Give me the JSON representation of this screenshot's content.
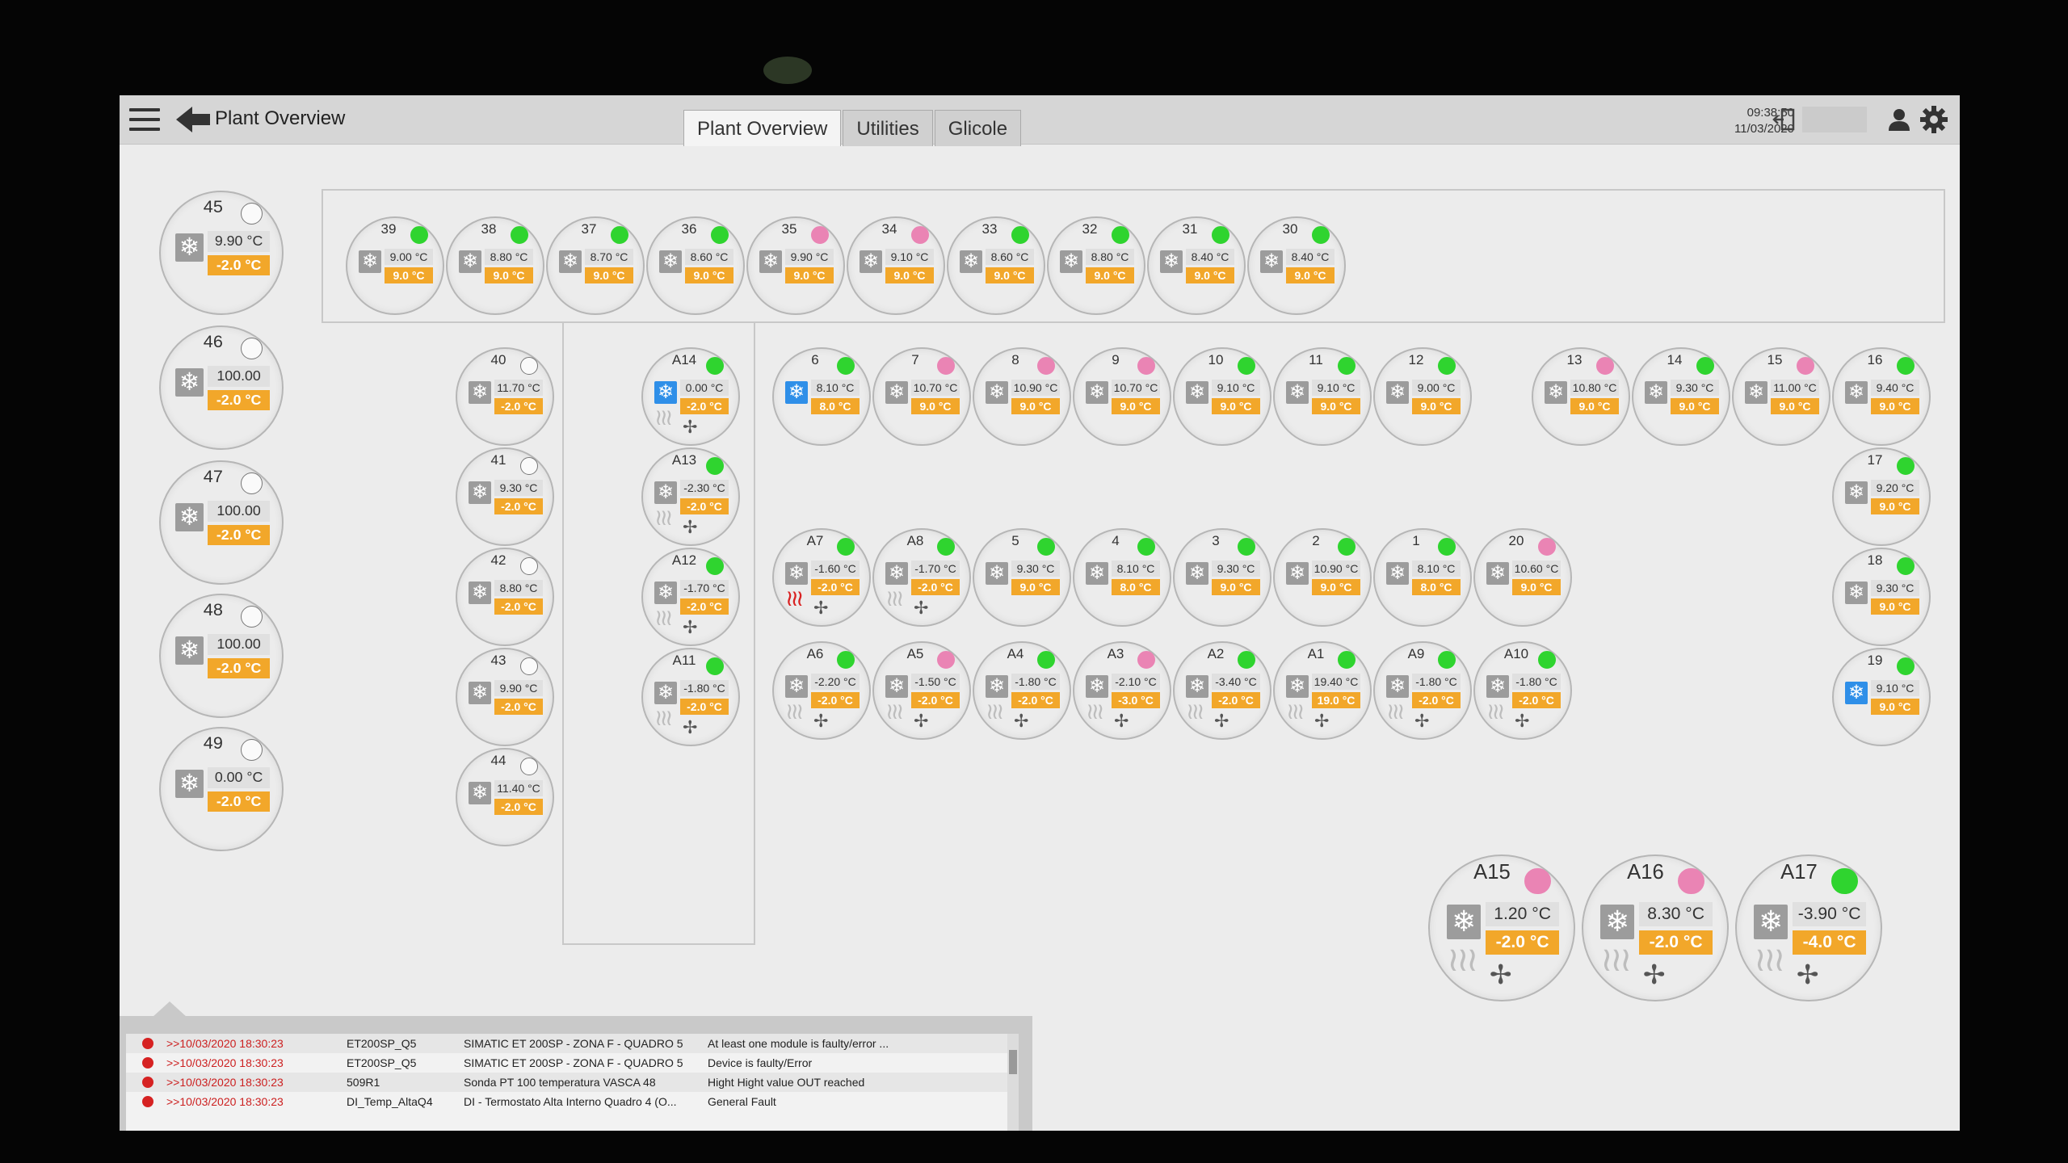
{
  "header": {
    "title": "Plant Overview",
    "tabs": [
      "Plant Overview",
      "Utilities",
      "Glicole"
    ],
    "active_tab": "Plant Overview",
    "time": "09:38:50",
    "date": "11/03/2020"
  },
  "units": [
    {
      "name": "45",
      "temp": "9.90 °C",
      "set": "-2.0 °C",
      "led": "white"
    },
    {
      "name": "46",
      "temp": "100.00 °C",
      "set": "-2.0 °C",
      "led": "white"
    },
    {
      "name": "47",
      "temp": "100.00 °C",
      "set": "-2.0 °C",
      "led": "white"
    },
    {
      "name": "48",
      "temp": "100.00 °C",
      "set": "-2.0 °C",
      "led": "white"
    },
    {
      "name": "49",
      "temp": "0.00 °C",
      "set": "-2.0 °C",
      "led": "white"
    },
    {
      "name": "39",
      "temp": "9.00 °C",
      "set": "9.0 °C",
      "led": "green"
    },
    {
      "name": "38",
      "temp": "8.80 °C",
      "set": "9.0 °C",
      "led": "green"
    },
    {
      "name": "37",
      "temp": "8.70 °C",
      "set": "9.0 °C",
      "led": "green"
    },
    {
      "name": "36",
      "temp": "8.60 °C",
      "set": "9.0 °C",
      "led": "green"
    },
    {
      "name": "35",
      "temp": "9.90 °C",
      "set": "9.0 °C",
      "led": "pink"
    },
    {
      "name": "34",
      "temp": "9.10 °C",
      "set": "9.0 °C",
      "led": "pink"
    },
    {
      "name": "33",
      "temp": "8.60 °C",
      "set": "9.0 °C",
      "led": "green"
    },
    {
      "name": "32",
      "temp": "8.80 °C",
      "set": "9.0 °C",
      "led": "green"
    },
    {
      "name": "31",
      "temp": "8.40 °C",
      "set": "9.0 °C",
      "led": "green"
    },
    {
      "name": "30",
      "temp": "8.40 °C",
      "set": "9.0 °C",
      "led": "green"
    },
    {
      "name": "40",
      "temp": "11.70 °C",
      "set": "-2.0 °C",
      "led": "white"
    },
    {
      "name": "41",
      "temp": "9.30 °C",
      "set": "-2.0 °C",
      "led": "white"
    },
    {
      "name": "42",
      "temp": "8.80 °C",
      "set": "-2.0 °C",
      "led": "white"
    },
    {
      "name": "43",
      "temp": "9.90 °C",
      "set": "-2.0 °C",
      "led": "white"
    },
    {
      "name": "44",
      "temp": "11.40 °C",
      "set": "-2.0 °C",
      "led": "white"
    },
    {
      "name": "A14",
      "temp": "0.00 °C",
      "set": "-2.0 °C",
      "led": "green",
      "snow": "blue",
      "heat": "grey",
      "fan": true
    },
    {
      "name": "A13",
      "temp": "-2.30 °C",
      "set": "-2.0 °C",
      "led": "green",
      "heat": "grey",
      "fan": true
    },
    {
      "name": "A12",
      "temp": "-1.70 °C",
      "set": "-2.0 °C",
      "led": "green",
      "heat": "grey",
      "fan": true
    },
    {
      "name": "A11",
      "temp": "-1.80 °C",
      "set": "-2.0 °C",
      "led": "green",
      "heat": "grey",
      "fan": true
    },
    {
      "name": "6",
      "temp": "8.10 °C",
      "set": "8.0 °C",
      "led": "green",
      "snow": "blue"
    },
    {
      "name": "7",
      "temp": "10.70 °C",
      "set": "9.0 °C",
      "led": "pink"
    },
    {
      "name": "8",
      "temp": "10.90 °C",
      "set": "9.0 °C",
      "led": "pink"
    },
    {
      "name": "9",
      "temp": "10.70 °C",
      "set": "9.0 °C",
      "led": "pink"
    },
    {
      "name": "10",
      "temp": "9.10 °C",
      "set": "9.0 °C",
      "led": "green"
    },
    {
      "name": "11",
      "temp": "9.10 °C",
      "set": "9.0 °C",
      "led": "green"
    },
    {
      "name": "12",
      "temp": "9.00 °C",
      "set": "9.0 °C",
      "led": "green"
    },
    {
      "name": "13",
      "temp": "10.80 °C",
      "set": "9.0 °C",
      "led": "pink"
    },
    {
      "name": "14",
      "temp": "9.30 °C",
      "set": "9.0 °C",
      "led": "green"
    },
    {
      "name": "15",
      "temp": "11.00 °C",
      "set": "9.0 °C",
      "led": "pink"
    },
    {
      "name": "16",
      "temp": "9.40 °C",
      "set": "9.0 °C",
      "led": "green"
    },
    {
      "name": "17",
      "temp": "9.20 °C",
      "set": "9.0 °C",
      "led": "green"
    },
    {
      "name": "18",
      "temp": "9.30 °C",
      "set": "9.0 °C",
      "led": "green"
    },
    {
      "name": "19",
      "temp": "9.10 °C",
      "set": "9.0 °C",
      "led": "green",
      "snow": "blue"
    },
    {
      "name": "A7",
      "temp": "-1.60 °C",
      "set": "-2.0 °C",
      "led": "green",
      "heat": "red",
      "fan": true
    },
    {
      "name": "A8",
      "temp": "-1.70 °C",
      "set": "-2.0 °C",
      "led": "green",
      "heat": "grey",
      "fan": true
    },
    {
      "name": "5",
      "temp": "9.30 °C",
      "set": "9.0 °C",
      "led": "green"
    },
    {
      "name": "4",
      "temp": "8.10 °C",
      "set": "8.0 °C",
      "led": "green"
    },
    {
      "name": "3",
      "temp": "9.30 °C",
      "set": "9.0 °C",
      "led": "green"
    },
    {
      "name": "2",
      "temp": "10.90 °C",
      "set": "9.0 °C",
      "led": "green"
    },
    {
      "name": "1",
      "temp": "8.10 °C",
      "set": "8.0 °C",
      "led": "green"
    },
    {
      "name": "20",
      "temp": "10.60 °C",
      "set": "9.0 °C",
      "led": "pink"
    },
    {
      "name": "A6",
      "temp": "-2.20 °C",
      "set": "-2.0 °C",
      "led": "green",
      "heat": "grey",
      "fan": true
    },
    {
      "name": "A5",
      "temp": "-1.50 °C",
      "set": "-2.0 °C",
      "led": "pink",
      "heat": "grey",
      "fan": true
    },
    {
      "name": "A4",
      "temp": "-1.80 °C",
      "set": "-2.0 °C",
      "led": "green",
      "heat": "grey",
      "fan": true
    },
    {
      "name": "A3",
      "temp": "-2.10 °C",
      "set": "-3.0 °C",
      "led": "pink",
      "heat": "grey",
      "fan": true
    },
    {
      "name": "A2",
      "temp": "-3.40 °C",
      "set": "-2.0 °C",
      "led": "green",
      "heat": "grey",
      "fan": true
    },
    {
      "name": "A1",
      "temp": "19.40 °C",
      "set": "19.0 °C",
      "led": "green",
      "heat": "grey",
      "fan": true
    },
    {
      "name": "A9",
      "temp": "-1.80 °C",
      "set": "-2.0 °C",
      "led": "green",
      "heat": "grey",
      "fan": true
    },
    {
      "name": "A10",
      "temp": "-1.80 °C",
      "set": "-2.0 °C",
      "led": "green",
      "heat": "grey",
      "fan": true
    },
    {
      "name": "A15",
      "temp": "1.20 °C",
      "set": "-2.0 °C",
      "led": "pink",
      "heat": "grey",
      "fan": true
    },
    {
      "name": "A16",
      "temp": "8.30 °C",
      "set": "-2.0 °C",
      "led": "pink",
      "heat": "grey",
      "fan": true
    },
    {
      "name": "A17",
      "temp": "-3.90 °C",
      "set": "-4.0 °C",
      "led": "green",
      "heat": "grey",
      "fan": true
    }
  ],
  "alarms": [
    {
      "time": ">>10/03/2020 18:30:23",
      "source": "ET200SP_Q5",
      "description": "SIMATIC ET 200SP - ZONA F - QUADRO 5",
      "message": "At least one module is faulty/error ..."
    },
    {
      "time": ">>10/03/2020 18:30:23",
      "source": "ET200SP_Q5",
      "description": "SIMATIC ET 200SP - ZONA F - QUADRO 5",
      "message": "Device is faulty/Error"
    },
    {
      "time": ">>10/03/2020 18:30:23",
      "source": "509R1",
      "description": "Sonda PT 100 temperatura VASCA 48",
      "message": "Hight Hight value OUT reached"
    },
    {
      "time": ">>10/03/2020 18:30:23",
      "source": "DI_Temp_AltaQ4",
      "description": "DI - Termostato Alta Interno Quadro 4 (O...",
      "message": "General Fault"
    }
  ]
}
